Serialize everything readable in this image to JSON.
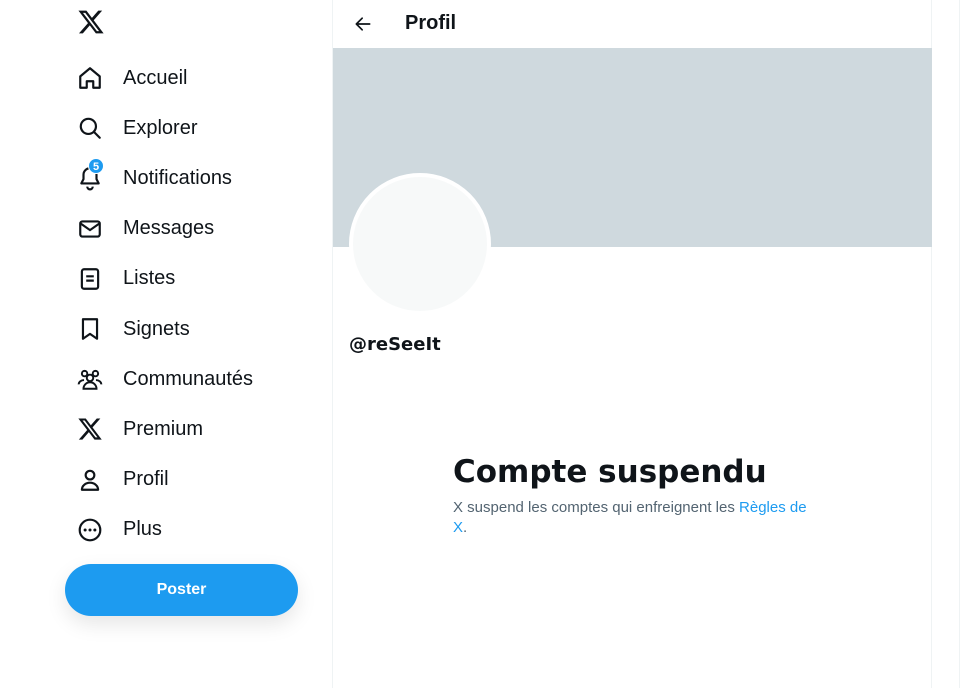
{
  "sidebar": {
    "logo_icon": "x-logo-icon",
    "items": [
      {
        "label": "Accueil",
        "icon": "home-icon"
      },
      {
        "label": "Explorer",
        "icon": "search-icon"
      },
      {
        "label": "Notifications",
        "icon": "bell-icon",
        "badge": "5"
      },
      {
        "label": "Messages",
        "icon": "envelope-icon"
      },
      {
        "label": "Listes",
        "icon": "list-icon"
      },
      {
        "label": "Signets",
        "icon": "bookmark-icon"
      },
      {
        "label": "Communautés",
        "icon": "communities-icon"
      },
      {
        "label": "Premium",
        "icon": "x-logo-icon"
      },
      {
        "label": "Profil",
        "icon": "person-icon"
      },
      {
        "label": "Plus",
        "icon": "more-circle-icon"
      }
    ],
    "post_label": "Poster"
  },
  "header": {
    "title": "Profil",
    "back_icon": "arrow-left-icon"
  },
  "profile": {
    "handle": "@reSeeIt"
  },
  "suspension": {
    "title": "Compte suspendu",
    "text": "X suspend les comptes qui enfreignent les ",
    "link": "Règles de X",
    "suffix": "."
  },
  "colors": {
    "accent": "#1d9bf0",
    "banner": "#cfd9de",
    "text": "#0f1419",
    "secondary_text": "#536471"
  }
}
